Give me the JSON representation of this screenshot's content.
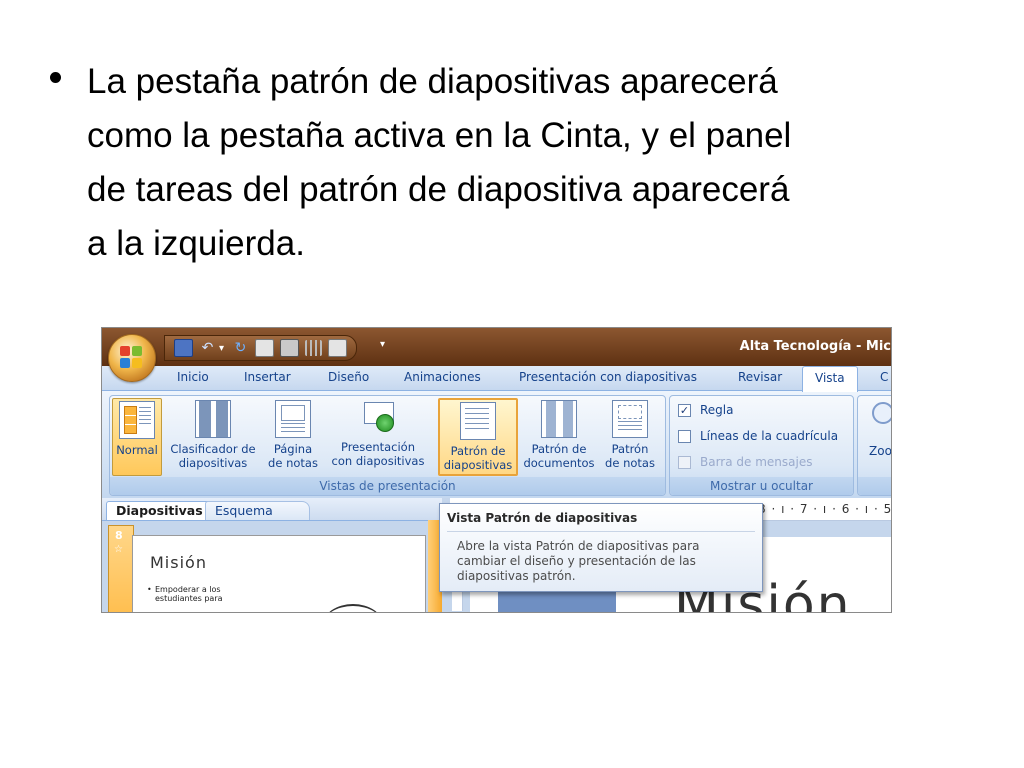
{
  "slide": {
    "bullet_lines": [
      "La pestaña patrón de diapositivas aparecerá",
      "como la pestaña activa en la Cinta, y el panel",
      "de tareas del patrón de diapositiva aparecerá",
      "a la izquierda."
    ]
  },
  "window": {
    "title": "Alta Tecnología - Mic"
  },
  "tabs": [
    "Inicio",
    "Insertar",
    "Diseño",
    "Animaciones",
    "Presentación con diapositivas",
    "Revisar",
    "Vista",
    "C"
  ],
  "active_tab": "Vista",
  "ribbon": {
    "views_group": {
      "label": "Vistas de presentación",
      "buttons": [
        {
          "lines": [
            "Normal"
          ],
          "icon": "normal-view-icon"
        },
        {
          "lines": [
            "Clasificador de",
            "diapositivas"
          ],
          "icon": "slide-sorter-icon"
        },
        {
          "lines": [
            "Página",
            "de notas"
          ],
          "icon": "notes-page-icon"
        },
        {
          "lines": [
            "Presentación",
            "con diapositivas"
          ],
          "icon": "slide-show-icon"
        },
        {
          "lines": [
            "Patrón de",
            "diapositivas"
          ],
          "icon": "slide-master-icon"
        },
        {
          "lines": [
            "Patrón de",
            "documentos"
          ],
          "icon": "handout-master-icon"
        },
        {
          "lines": [
            "Patrón",
            "de notas"
          ],
          "icon": "notes-master-icon"
        }
      ]
    },
    "show_group": {
      "label": "Mostrar u ocultar",
      "checks": [
        {
          "label": "Regla",
          "checked": true,
          "enabled": true
        },
        {
          "label": "Líneas de la cuadrícula",
          "checked": false,
          "enabled": true
        },
        {
          "label": "Barra de mensajes",
          "checked": false,
          "enabled": false
        }
      ]
    },
    "zoom_group": {
      "label": "Zoo"
    }
  },
  "pane": {
    "tabs": [
      "Diapositivas",
      "Esquema"
    ],
    "slide_number": "8",
    "thumb_title": "Misión",
    "thumb_bullet_lines": [
      "Empoderar a los",
      "estudiantes para"
    ]
  },
  "ruler": {
    "text": "8 · ı · 7 · ı · 6 · ı · 5 ·"
  },
  "editor": {
    "big_title": "Misión"
  },
  "tooltip": {
    "title": "Vista Patrón de diapositivas",
    "body_lines": [
      "Abre la vista Patrón de diapositivas para",
      "cambiar el diseño y presentación de las",
      "diapositivas patrón."
    ]
  },
  "colors": {
    "ribbon_blue": "#c5d8f0",
    "title_bar_brown": "#6e3a16",
    "selected_orange": "#ffc85a"
  }
}
